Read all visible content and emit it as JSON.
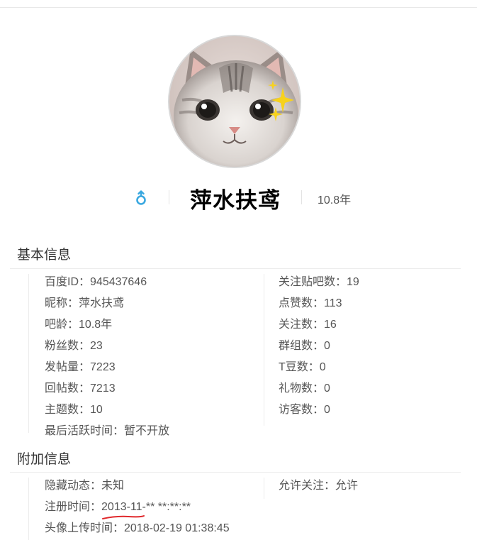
{
  "profile": {
    "nickname": "萍水扶鸢",
    "age": "10.8年",
    "gender": "male"
  },
  "basic": {
    "title": "基本信息",
    "left": [
      {
        "label": "百度ID：",
        "value": "945437646"
      },
      {
        "label": "昵称：",
        "value": "萍水扶鸢"
      },
      {
        "label": "吧龄：",
        "value": "10.8年"
      },
      {
        "label": "粉丝数：",
        "value": "23"
      },
      {
        "label": "发帖量：",
        "value": "7223"
      },
      {
        "label": "回帖数：",
        "value": "7213"
      },
      {
        "label": "主题数：",
        "value": "10"
      },
      {
        "label": "最后活跃时间：",
        "value": "暂不开放"
      }
    ],
    "right": [
      {
        "label": "关注贴吧数：",
        "value": "19"
      },
      {
        "label": "点赞数：",
        "value": "113"
      },
      {
        "label": "关注数：",
        "value": "16"
      },
      {
        "label": "群组数：",
        "value": "0"
      },
      {
        "label": "T豆数：",
        "value": "0"
      },
      {
        "label": "礼物数：",
        "value": "0"
      },
      {
        "label": "访客数：",
        "value": "0"
      }
    ]
  },
  "extra": {
    "title": "附加信息",
    "hidden_label": "隐藏动态：",
    "hidden_value": "未知",
    "follow_label": "允许关注：",
    "follow_value": "允许",
    "reg_label": "注册时间：",
    "reg_value_main": "2013-11",
    "reg_value_rest": "-** **:**:**",
    "upload_label": "头像上传时间：",
    "upload_value": "2018-02-19 01:38:45"
  },
  "colors": {
    "gender_icon": "#3aa8e0",
    "annotation": "#e0282c"
  }
}
